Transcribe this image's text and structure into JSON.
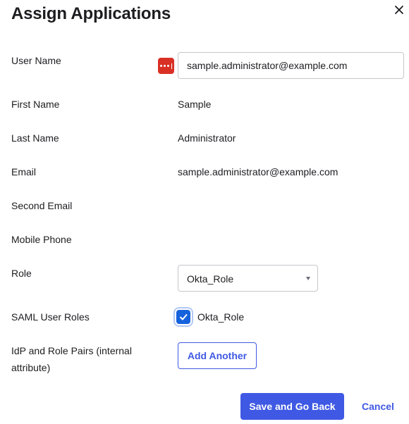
{
  "dialog": {
    "title": "Assign Applications",
    "close_icon": "close-icon"
  },
  "form": {
    "user_name": {
      "label": "User Name",
      "value": "sample.administrator@example.com",
      "icon": "password-manager-icon"
    },
    "first_name": {
      "label": "First Name",
      "value": "Sample"
    },
    "last_name": {
      "label": "Last Name",
      "value": "Administrator"
    },
    "email": {
      "label": "Email",
      "value": "sample.administrator@example.com"
    },
    "second_email": {
      "label": "Second Email",
      "value": ""
    },
    "mobile_phone": {
      "label": "Mobile Phone",
      "value": ""
    },
    "role": {
      "label": "Role",
      "selected": "Okta_Role"
    },
    "saml_user_roles": {
      "label": "SAML User Roles",
      "option": "Okta_Role",
      "checked": true
    },
    "idp_role_pairs": {
      "label_line1": "IdP and Role Pairs (internal",
      "label_line2": "attribute)",
      "button": "Add Another"
    }
  },
  "footer": {
    "save_label": "Save and Go Back",
    "cancel_label": "Cancel"
  },
  "colors": {
    "primary": "#3f59e4",
    "checkbox": "#1662dd",
    "password_icon": "#d93025",
    "text": "#1d1d21"
  }
}
